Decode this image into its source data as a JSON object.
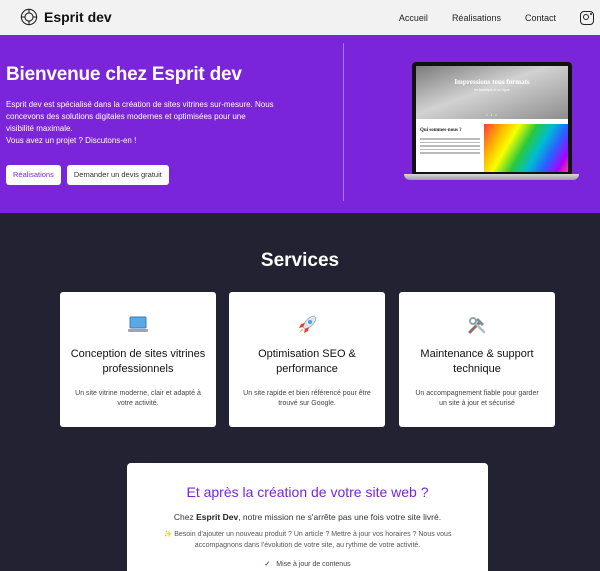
{
  "header": {
    "brand": "Esprit dev",
    "nav": [
      "Accueil",
      "Réalisations",
      "Contact"
    ]
  },
  "hero": {
    "title": "Bienvenue chez Esprit dev",
    "desc_lines": [
      "Esprit dev est spécialisé dans la création de sites vitrines sur-mesure. Nous",
      "concevons des solutions digitales modernes et optimisées pour une",
      "visibilité maximale.",
      "Vous avez un projet ? Discutons-en !"
    ],
    "buttons": [
      "Réalisations",
      "Demander un devis gratuit"
    ],
    "mockup": {
      "title": "Impressions tous formats",
      "subtitle": "en boutique et en ligne",
      "section": "Qui sommes-nous ?"
    }
  },
  "services": {
    "title": "Services",
    "cards": [
      {
        "icon": "laptop-icon",
        "title": "Conception de sites vitrines professionnels",
        "desc": "Un site vitrine moderne, clair et adapté à votre activité."
      },
      {
        "icon": "rocket-icon",
        "title": "Optimisation SEO & performance",
        "desc": "Un site rapide et bien référencé pour être trouvé sur Google."
      },
      {
        "icon": "tools-icon",
        "title": "Maintenance & support technique",
        "desc": "Un accompagnement fiable pour garder un site à jour et sécurisé"
      }
    ]
  },
  "after": {
    "title": "Et après la création de votre site web ?",
    "line1_prefix": "Chez ",
    "line1_brand": "Esprit Dev",
    "line1_suffix": ", notre mission ne s'arrête pas une fois votre site livré.",
    "line2": "✨ Besoin d'ajouter un nouveau produit ? Un article ? Mettre à jour vos horaires ? Nous vous accompagnons dans l'évolution de votre site, au rythme de votre activité.",
    "check_item": "Mise à jour de contenus"
  },
  "colors": {
    "accent": "#7a25d9",
    "dark_bg": "#232233",
    "header_bg": "#f2f2f2"
  }
}
